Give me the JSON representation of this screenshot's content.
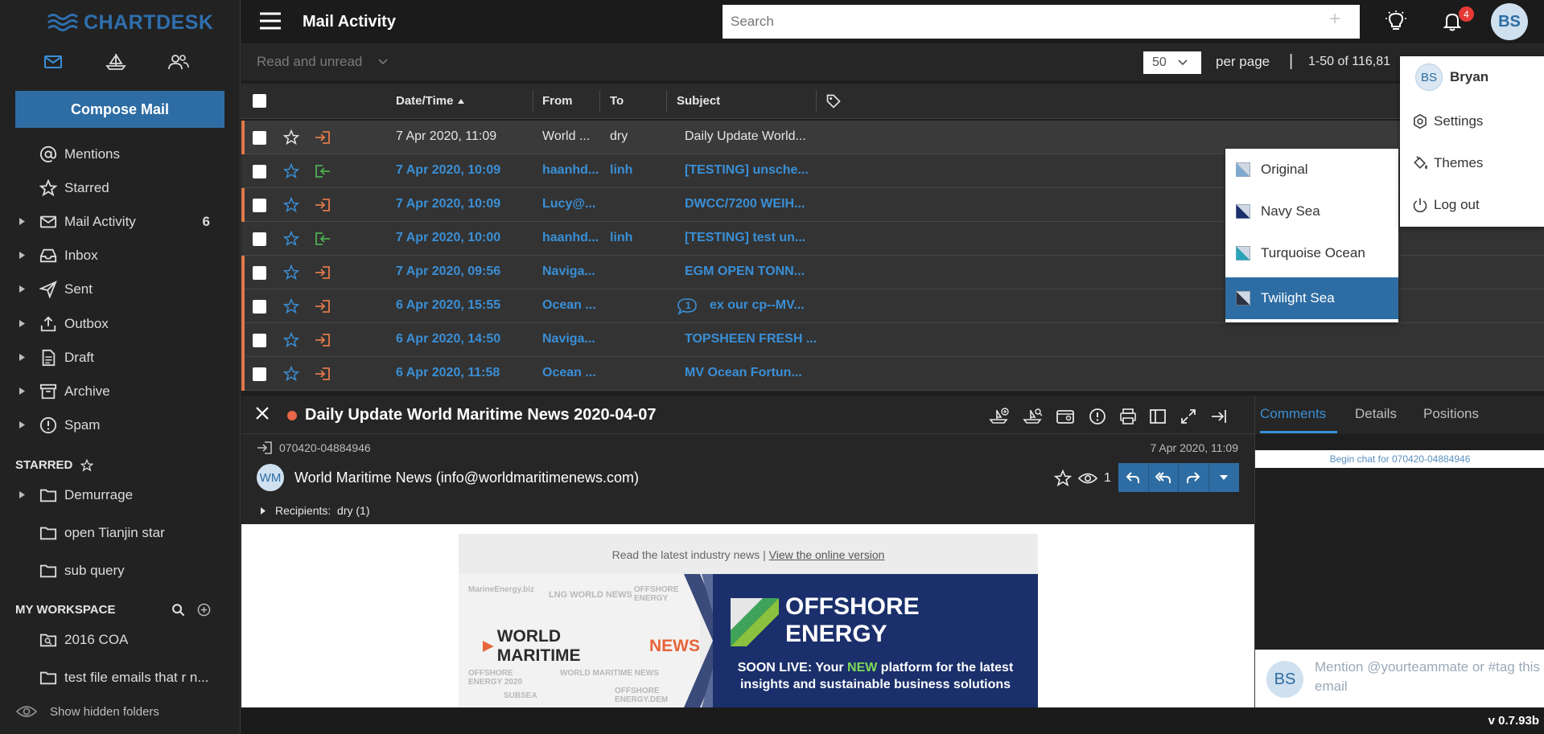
{
  "app": {
    "logo": "CHARTDESK",
    "version": "v 0.7.93b",
    "colors": {
      "accent": "#2e6da4",
      "unread": "#3a8fd6",
      "outgoing": "#e07a4a",
      "incoming": "#4caf50",
      "badge": "#e53935"
    }
  },
  "sidebar": {
    "compose_label": "Compose Mail",
    "nav_icons": [
      "mail-icon",
      "ship-icon",
      "users-icon"
    ],
    "folders": [
      {
        "label": "Mentions",
        "icon": "at-icon",
        "expandable": false,
        "count": ""
      },
      {
        "label": "Starred",
        "icon": "star-icon",
        "expandable": false,
        "count": ""
      },
      {
        "label": "Mail Activity",
        "icon": "mail-icon",
        "expandable": true,
        "count": "6"
      },
      {
        "label": "Inbox",
        "icon": "inbox-icon",
        "expandable": true,
        "count": ""
      },
      {
        "label": "Sent",
        "icon": "send-icon",
        "expandable": true,
        "count": ""
      },
      {
        "label": "Outbox",
        "icon": "upload-icon",
        "expandable": true,
        "count": ""
      },
      {
        "label": "Draft",
        "icon": "document-icon",
        "expandable": true,
        "count": ""
      },
      {
        "label": "Archive",
        "icon": "archive-icon",
        "expandable": true,
        "count": ""
      },
      {
        "label": "Spam",
        "icon": "alert-icon",
        "expandable": true,
        "count": ""
      }
    ],
    "starred_header": "STARRED",
    "starred_folders": [
      {
        "label": "Demurrage",
        "expandable": true
      },
      {
        "label": "open Tianjin star",
        "expandable": false
      },
      {
        "label": "sub query",
        "expandable": false
      }
    ],
    "workspace_header": "MY WORKSPACE",
    "workspace_folders": [
      {
        "label": "2016 COA",
        "icon": "search-folder-icon"
      },
      {
        "label": "test file emails that r n...",
        "icon": "folder-icon"
      }
    ],
    "show_hidden": "Show hidden folders"
  },
  "header": {
    "title": "Mail Activity",
    "search_placeholder": "Search",
    "notification_count": "4",
    "user_initials": "BS"
  },
  "toolbar": {
    "filter": "Read and unread",
    "per_page_value": "50",
    "per_page_label": "per page",
    "separator": "|",
    "range": "1-50 of 116,81"
  },
  "table": {
    "columns": {
      "date": "Date/Time",
      "from": "From",
      "to": "To",
      "subject": "Subject"
    },
    "rows": [
      {
        "date": "7 Apr 2020, 11:09",
        "from": "World ...",
        "to": "dry",
        "subject": "Daily Update World...",
        "direction": "out",
        "unread": false,
        "comment": ""
      },
      {
        "date": "7 Apr 2020, 10:09",
        "from": "haanhd...",
        "to": "linh",
        "subject": "[TESTING] unsche...",
        "direction": "in",
        "unread": true,
        "comment": ""
      },
      {
        "date": "7 Apr 2020, 10:09",
        "from": "Lucy@...",
        "to": "",
        "subject": "DWCC/7200 WEIH...",
        "direction": "out",
        "unread": true,
        "comment": ""
      },
      {
        "date": "7 Apr 2020, 10:00",
        "from": "haanhd...",
        "to": "linh",
        "subject": "[TESTING] test un...",
        "direction": "in",
        "unread": true,
        "comment": ""
      },
      {
        "date": "7 Apr 2020, 09:56",
        "from": "Naviga...",
        "to": "",
        "subject": "EGM OPEN TONN...",
        "direction": "out",
        "unread": true,
        "comment": ""
      },
      {
        "date": "6 Apr 2020, 15:55",
        "from": "Ocean ...",
        "to": "",
        "subject": "ex our cp--MV...",
        "direction": "out",
        "unread": true,
        "comment": "1"
      },
      {
        "date": "6 Apr 2020, 14:50",
        "from": "Naviga...",
        "to": "",
        "subject": "TOPSHEEN FRESH ...",
        "direction": "out",
        "unread": true,
        "comment": ""
      },
      {
        "date": "6 Apr 2020, 11:58",
        "from": "Ocean ...",
        "to": "",
        "subject": "MV Ocean Fortun...",
        "direction": "out",
        "unread": true,
        "comment": ""
      }
    ]
  },
  "reader": {
    "title": "Daily Update World Maritime News 2020-04-07",
    "mail_id": "070420-04884946",
    "date": "7 Apr 2020, 11:09",
    "sender_initials": "WM",
    "sender": "World Maritime News (info@worldmaritimenews.com)",
    "views": "1",
    "recipients_label": "Recipients:",
    "recipients": "dry (1)",
    "newsletter": {
      "top_text": "Read the latest industry news |",
      "top_link": "View the online version",
      "wmn_world": "WORLD MARITIME",
      "wmn_news": "NEWS",
      "faint_1": "MarineEnergy.biz",
      "faint_2": "LNG WORLD NEWS",
      "faint_3": "OFFSHORE ENERGY",
      "faint_4": "OFFSHORE ENERGY 2020",
      "faint_5": "WORLD MARITIME NEWS",
      "faint_6": "SUBSEA",
      "faint_7": "OFFSHORE ENERGY.DEM",
      "oe_line1": "OFFSHORE",
      "oe_line2": "ENERGY",
      "soon_pre": "SOON LIVE: Your ",
      "soon_new": "NEW",
      "soon_post": " platform for the latest",
      "soon_line2": "insights and sustainable business solutions"
    }
  },
  "side_pane": {
    "tabs": [
      "Comments",
      "Details",
      "Positions"
    ],
    "chat_banner": "Begin chat for 070420-04884946",
    "user_initials": "BS",
    "chat_placeholder": "Mention @yourteammate or #tag this email"
  },
  "theme_menu": {
    "items": [
      {
        "label": "Original",
        "swatch": "#7fa9cf",
        "active": false
      },
      {
        "label": "Navy Sea",
        "swatch": "#1a2f6b",
        "active": false
      },
      {
        "label": "Turquoise Ocean",
        "swatch": "#2aa3b8",
        "active": false
      },
      {
        "label": "Twilight Sea",
        "swatch": "#2b3344",
        "active": true
      }
    ]
  },
  "user_menu": {
    "initials": "BS",
    "name": "Bryan",
    "items": [
      {
        "label": "Settings",
        "icon": "gear-icon"
      },
      {
        "label": "Themes",
        "icon": "paint-bucket-icon"
      },
      {
        "label": "Log out",
        "icon": "power-icon"
      }
    ]
  }
}
